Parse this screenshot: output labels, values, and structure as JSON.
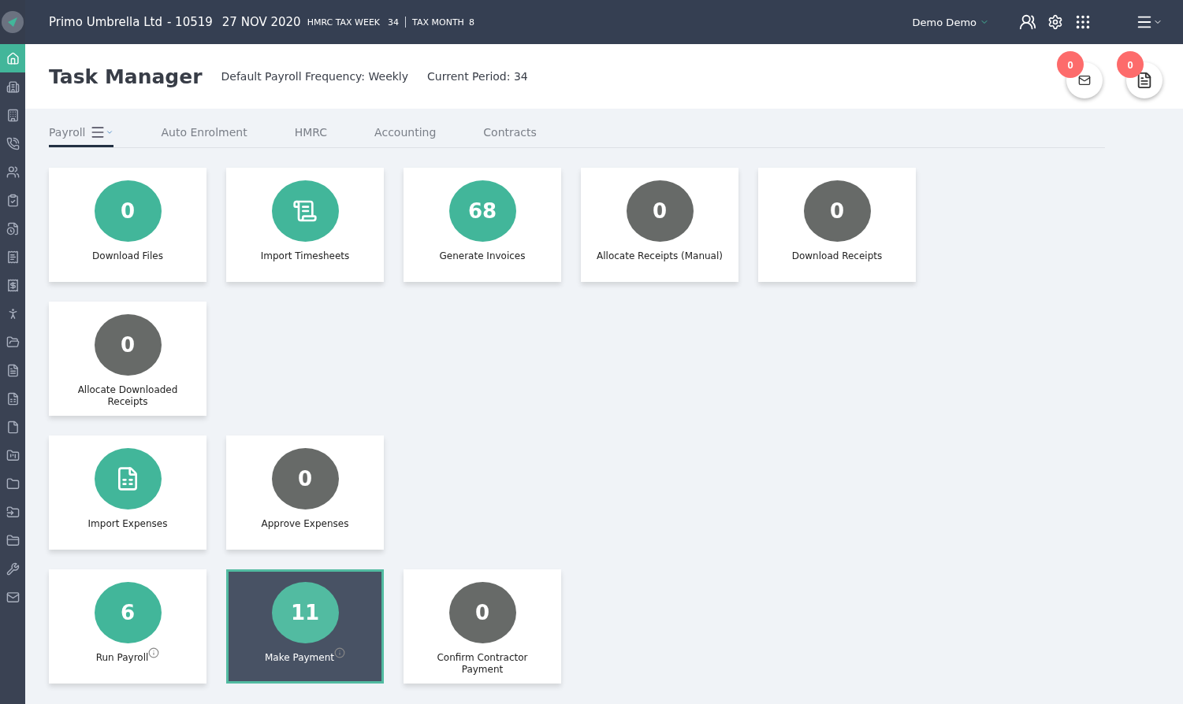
{
  "topbar": {
    "company": "Primo Umbrella Ltd",
    "code": "- 10519",
    "date": "27 NOV 2020",
    "tax_week_label": "HMRC TAX WEEK",
    "tax_week": "34",
    "tax_month_label": "TAX MONTH",
    "tax_month": "8",
    "user": "Demo Demo"
  },
  "sidebar": {
    "items": [
      {
        "selected": true
      },
      {
        "selected": false
      },
      {
        "selected": false
      },
      {
        "selected": false
      },
      {
        "selected": false
      },
      {
        "selected": false
      },
      {
        "selected": false
      },
      {
        "selected": false
      },
      {
        "selected": false
      },
      {
        "selected": false
      },
      {
        "selected": false
      },
      {
        "selected": false
      },
      {
        "selected": false
      },
      {
        "selected": false
      },
      {
        "selected": false
      },
      {
        "selected": false
      },
      {
        "selected": false
      },
      {
        "selected": false
      },
      {
        "selected": false
      },
      {
        "selected": false
      }
    ]
  },
  "header": {
    "title": "Task Manager",
    "frequency": "Default Payroll Frequency: Weekly",
    "period": "Current Period: 34",
    "notifications": [
      {
        "kind": "mail",
        "count": "0"
      },
      {
        "kind": "document",
        "count": "0"
      }
    ]
  },
  "tabs": [
    {
      "label": "Payroll",
      "selected": true,
      "menu": true
    },
    {
      "label": "Auto Enrolment",
      "selected": false
    },
    {
      "label": "HMRC",
      "selected": false
    },
    {
      "label": "Accounting",
      "selected": false
    },
    {
      "label": "Contracts",
      "selected": false
    }
  ],
  "tile_rows": [
    [
      {
        "kind": "count",
        "color": "#42b69a",
        "value": "0",
        "label": "Download Files",
        "selected": false
      },
      {
        "kind": "icon",
        "color": "#42b69a",
        "label": "Import Timesheets",
        "selected": false
      },
      {
        "kind": "count",
        "color": "#42b69a",
        "value": "68",
        "label": "Generate Invoices",
        "selected": false
      },
      {
        "kind": "count",
        "color": "#676a68",
        "value": "0",
        "label": "Allocate Receipts (Manual)",
        "selected": false
      },
      {
        "kind": "count",
        "color": "#676a68",
        "value": "0",
        "label": "Download Receipts",
        "selected": false
      }
    ],
    [
      {
        "kind": "count",
        "color": "#676a68",
        "value": "0",
        "label": "Allocate Downloaded Receipts",
        "selected": false
      }
    ],
    [
      {
        "kind": "icon",
        "color": "#42b69a",
        "label": "Import Expenses",
        "selected": false
      },
      {
        "kind": "count",
        "color": "#676a68",
        "value": "0",
        "label": "Approve Expenses",
        "selected": false
      }
    ],
    [
      {
        "kind": "count",
        "color": "#42b69a",
        "value": "6",
        "label": "Run Payroll",
        "selected": false,
        "info": true
      },
      {
        "kind": "count",
        "color": "#52bba1",
        "value": "11",
        "label": "Make Payment",
        "selected": true,
        "info": true
      },
      {
        "kind": "count",
        "color": "#676a68",
        "value": "0",
        "label": "Confirm Contractor Payment",
        "selected": false
      }
    ]
  ]
}
